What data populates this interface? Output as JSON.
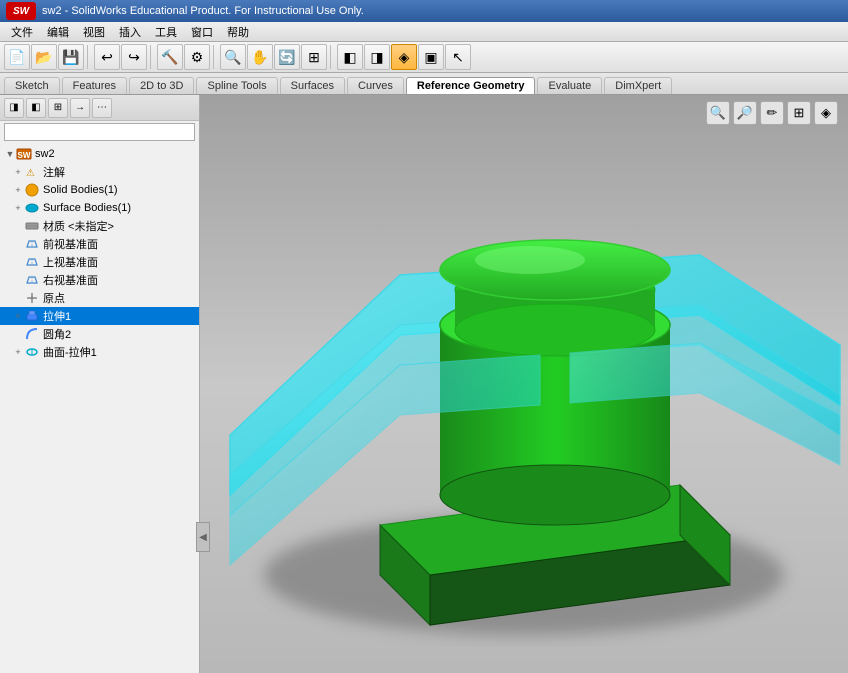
{
  "titlebar": {
    "logo": "SW",
    "title": "sw2 - SolidWorks Educational Product. For Instructional Use Only."
  },
  "menubar": {
    "items": [
      "文件",
      "编辑",
      "视图",
      "插入",
      "工具",
      "窗口",
      "帮助"
    ]
  },
  "tabs": {
    "items": [
      "Sketch",
      "Features",
      "2D to 3D",
      "Spline Tools",
      "Surfaces",
      "Curves",
      "Reference Geometry",
      "Evaluate",
      "DimXpert"
    ],
    "active": "Reference Geometry"
  },
  "toolbar": {
    "buttons": [
      {
        "name": "new",
        "icon": "📄"
      },
      {
        "name": "open",
        "icon": "📂"
      },
      {
        "name": "save",
        "icon": "💾"
      },
      {
        "name": "print",
        "icon": "🖨"
      },
      {
        "name": "undo",
        "icon": "↩"
      },
      {
        "name": "redo",
        "icon": "↪"
      },
      {
        "name": "select",
        "icon": "↖"
      },
      {
        "name": "zoom-in",
        "icon": "🔍"
      },
      {
        "name": "zoom-out",
        "icon": "🔎"
      },
      {
        "name": "pan",
        "icon": "✋"
      },
      {
        "name": "rotate",
        "icon": "🔄"
      },
      {
        "name": "active-tool",
        "icon": "◈",
        "active": true
      }
    ]
  },
  "panel_toolbar": {
    "buttons": [
      "◨",
      "◧",
      "⊞",
      "→",
      "⋯"
    ]
  },
  "tree": {
    "items": [
      {
        "id": "sw2",
        "label": "sw2",
        "level": 0,
        "expand": "",
        "icon_type": "root"
      },
      {
        "id": "annotation",
        "label": "注解",
        "level": 1,
        "expand": "+",
        "icon_type": "annotation"
      },
      {
        "id": "solid_bodies",
        "label": "Solid Bodies(1)",
        "level": 1,
        "expand": "+",
        "icon_type": "solid"
      },
      {
        "id": "surface_bodies",
        "label": "Surface Bodies(1)",
        "level": 1,
        "expand": "+",
        "icon_type": "surface"
      },
      {
        "id": "material",
        "label": "材质 <未指定>",
        "level": 1,
        "expand": "",
        "icon_type": "material"
      },
      {
        "id": "front_plane",
        "label": "前视基准面",
        "level": 1,
        "expand": "",
        "icon_type": "plane"
      },
      {
        "id": "top_plane",
        "label": "上视基准面",
        "level": 1,
        "expand": "",
        "icon_type": "plane"
      },
      {
        "id": "right_plane",
        "label": "右视基准面",
        "level": 1,
        "expand": "",
        "icon_type": "plane"
      },
      {
        "id": "origin",
        "label": "原点",
        "level": 1,
        "expand": "",
        "icon_type": "origin"
      },
      {
        "id": "extrude1",
        "label": "拉伸1",
        "level": 1,
        "expand": "+",
        "icon_type": "extrude",
        "selected": true
      },
      {
        "id": "fillet2",
        "label": "圆角2",
        "level": 1,
        "expand": "",
        "icon_type": "fillet"
      },
      {
        "id": "surface_extrude1",
        "label": "曲面-拉伸1",
        "level": 1,
        "expand": "+",
        "icon_type": "surface_extrude"
      }
    ]
  },
  "viewport": {
    "toolbar_buttons": [
      "🔍",
      "🔎",
      "✏️",
      "⊞",
      "◈"
    ]
  },
  "colors": {
    "viewport_bg_top": "#b0b0b0",
    "viewport_bg_bottom": "#d0d0d0",
    "cyan_surface": "#00d8e8",
    "green_solid": "#22cc22",
    "green_dark": "#228822",
    "shadow": "#606060"
  }
}
